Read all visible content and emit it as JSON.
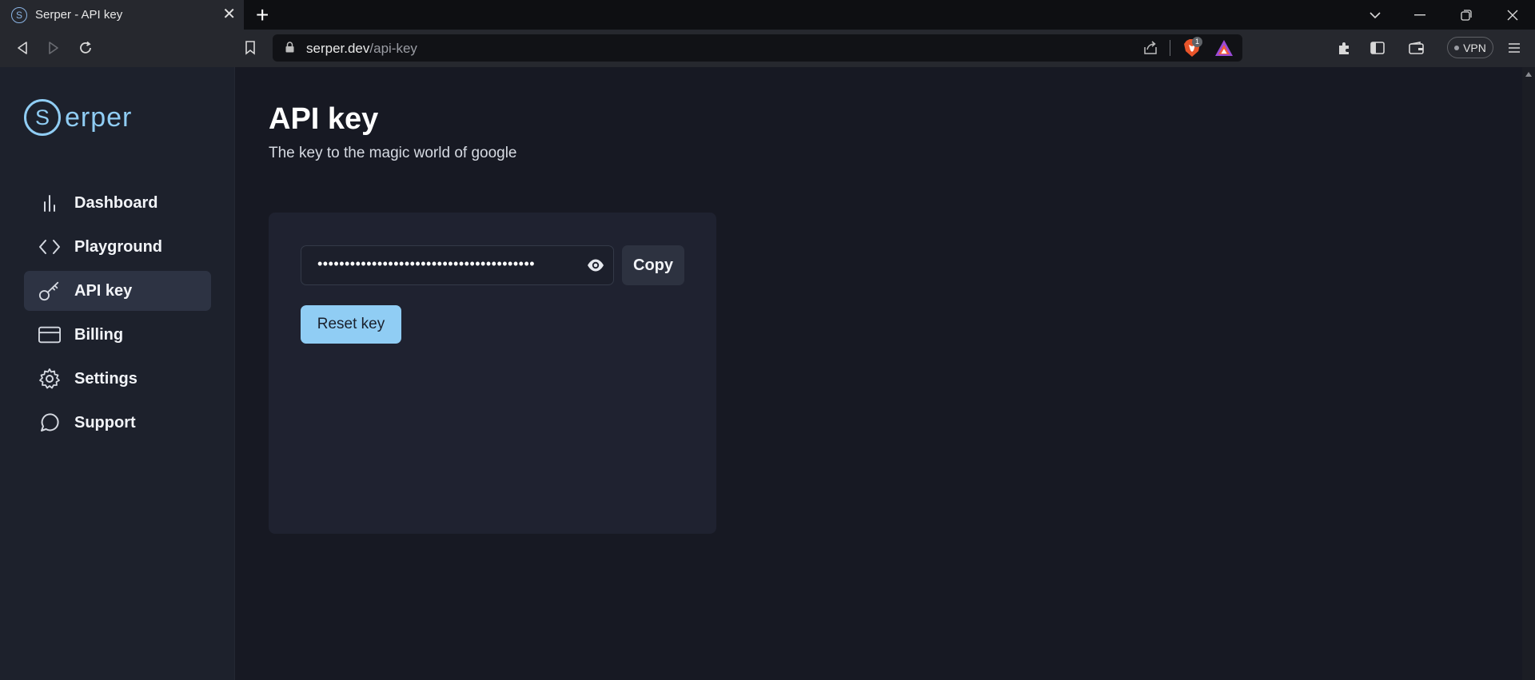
{
  "browser": {
    "tab_title": "Serper - API key",
    "tab_favicon_letter": "S",
    "tab_close": "✕",
    "new_tab": "+",
    "url_host": "serper.dev",
    "url_path": "/api-key",
    "brave_badge": "1",
    "vpn_label": "VPN",
    "window_controls": {
      "tab_search": "⌄",
      "minimize": "—",
      "restore": "❐",
      "close": "✕"
    },
    "nav": {
      "back": "◁",
      "forward": "▷",
      "reload": "↻"
    }
  },
  "logo": {
    "mark_letter": "S",
    "text": "erper"
  },
  "sidebar": {
    "items": [
      {
        "label": "Dashboard",
        "icon": "bar-chart-icon",
        "active": false
      },
      {
        "label": "Playground",
        "icon": "code-icon",
        "active": false
      },
      {
        "label": "API key",
        "icon": "key-icon",
        "active": true
      },
      {
        "label": "Billing",
        "icon": "credit-card-icon",
        "active": false
      },
      {
        "label": "Settings",
        "icon": "gear-icon",
        "active": false
      },
      {
        "label": "Support",
        "icon": "chat-bubble-icon",
        "active": false
      }
    ]
  },
  "main": {
    "title": "API key",
    "subtitle": "The key to the magic world of google"
  },
  "api_key": {
    "masked_value": "••••••••••••••••••••••••••••••••••••••••",
    "copy_label": "Copy",
    "reset_label": "Reset key"
  },
  "colors": {
    "accent": "#90cdf4",
    "page_bg": "#171923",
    "sidebar_bg": "#1d212c",
    "card_bg": "#1f2230",
    "active_nav_bg": "#2d3343"
  }
}
